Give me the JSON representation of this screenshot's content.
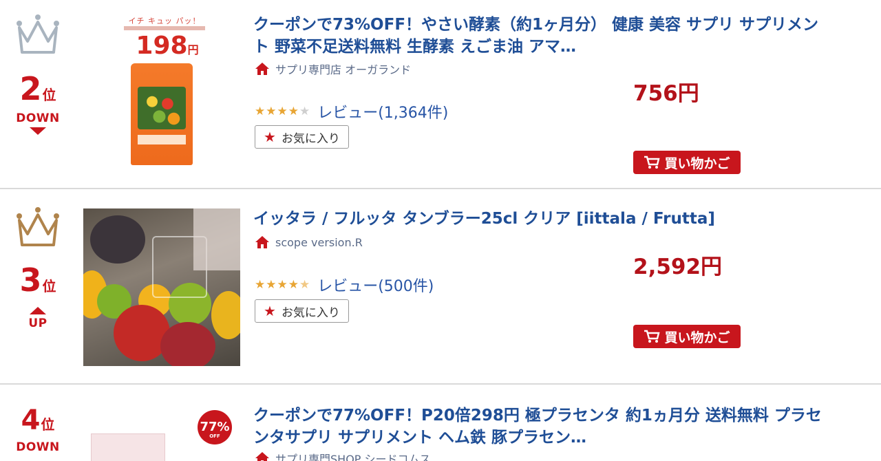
{
  "colors": {
    "rank_red": "#c8161d",
    "title_blue": "#1f4e96",
    "price_red": "#b3121a",
    "star": "#e8a534"
  },
  "items": [
    {
      "rank": "2",
      "rank_unit": "位",
      "trend": "DOWN",
      "crown_icon": "crown-silver-icon",
      "title_line1": "クーポンで73%OFF！やさい酵素（約1ヶ月分） 健康 美容 サプリ サプリメン",
      "title_line2": "ト 野菜不足送料無料 生酵素 えごま油 アマ…",
      "shop": "サプリ専門店 オーガランド",
      "price": "756円",
      "rating": 4,
      "review": "レビュー(1,364件)",
      "fav_label": "お気に入り",
      "cart_label": "買い物かご",
      "thumb_catch": "イチ キュッ パッ！",
      "thumb_price": "198",
      "thumb_price_unit": "円"
    },
    {
      "rank": "3",
      "rank_unit": "位",
      "trend": "UP",
      "crown_icon": "crown-bronze-icon",
      "title_line1": "イッタラ / フルッタ タンブラー25cl クリア [iittala / Frutta]",
      "shop": "scope version.R",
      "price": "2,592円",
      "rating": 4.5,
      "review": "レビュー(500件)",
      "fav_label": "お気に入り",
      "cart_label": "買い物かご"
    },
    {
      "rank": "4",
      "rank_unit": "位",
      "trend": "DOWN",
      "title_line1": "クーポンで77%OFF！P20倍298円 極プラセンタ 約1ヵ月分 送料無料 プラセ",
      "title_line2": "ンタサプリ サプリメント ヘム鉄 豚プラセン…",
      "shop": "サプリ専門SHOP シードコムス",
      "badge_value": "77%",
      "badge_bottom": "OFF"
    }
  ]
}
